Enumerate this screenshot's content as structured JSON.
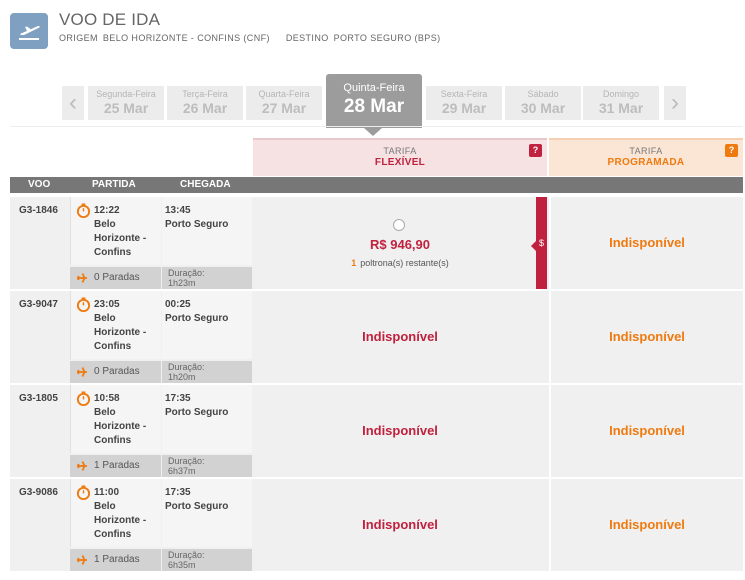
{
  "header": {
    "title": "VOO DE IDA",
    "origin_label": "ORIGEM",
    "origin_value": "BELO HORIZONTE - CONFINS (CNF)",
    "destination_label": "DESTINO",
    "destination_value": "PORTO SEGURO (BPS)",
    "icon": "plane-departure-icon"
  },
  "dates": [
    {
      "weekday": "Segunda-Feira",
      "date": "25 Mar"
    },
    {
      "weekday": "Terça-Feira",
      "date": "26 Mar"
    },
    {
      "weekday": "Quarta-Feira",
      "date": "27 Mar"
    },
    {
      "weekday": "Quinta-Feira",
      "date": "28 Mar",
      "selected": true
    },
    {
      "weekday": "Sexta-Feira",
      "date": "29 Mar"
    },
    {
      "weekday": "Sábado",
      "date": "30 Mar"
    },
    {
      "weekday": "Domingo",
      "date": "31 Mar"
    }
  ],
  "fares": {
    "flex": {
      "label": "TARIFA",
      "name": "FLEXÍVEL",
      "help": "?",
      "color": "#c0213e"
    },
    "prog": {
      "label": "TARIFA",
      "name": "PROGRAMADA",
      "help": "?",
      "color": "#ef7a0f"
    }
  },
  "columns": {
    "flight": "VOO",
    "departure": "PARTIDA",
    "arrival": "CHEGADA"
  },
  "labels": {
    "duration": "Duração:",
    "unavailable": "Indisponível",
    "seats_suffix": "poltrona(s) restante(s)",
    "fare_marker": "$"
  },
  "flights": [
    {
      "code": "G3-1846",
      "dep_time": "12:22",
      "dep_city": "Belo Horizonte - Confins",
      "arr_time": "13:45",
      "arr_city": "Porto Seguro",
      "stops": "0 Paradas",
      "duration": "1h23m",
      "flex_price": "R$ 946,90",
      "seats_left": "1",
      "prog": "Indisponível"
    },
    {
      "code": "G3-9047",
      "dep_time": "23:05",
      "dep_city": "Belo Horizonte - Confins",
      "arr_time": "00:25",
      "arr_city": "Porto Seguro",
      "stops": "0 Paradas",
      "duration": "1h20m",
      "flex": "Indisponível",
      "prog": "Indisponível"
    },
    {
      "code": "G3-1805",
      "dep_time": "10:58",
      "dep_city": "Belo Horizonte - Confins",
      "arr_time": "17:35",
      "arr_city": "Porto Seguro",
      "stops": "1 Paradas",
      "duration": "6h37m",
      "flex": "Indisponível",
      "prog": "Indisponível"
    },
    {
      "code": "G3-9086",
      "dep_time": "11:00",
      "dep_city": "Belo Horizonte - Confins",
      "arr_time": "17:35",
      "arr_city": "Porto Seguro",
      "stops": "1 Paradas",
      "duration": "6h35m",
      "flex": "Indisponível",
      "prog": "Indisponível"
    }
  ]
}
